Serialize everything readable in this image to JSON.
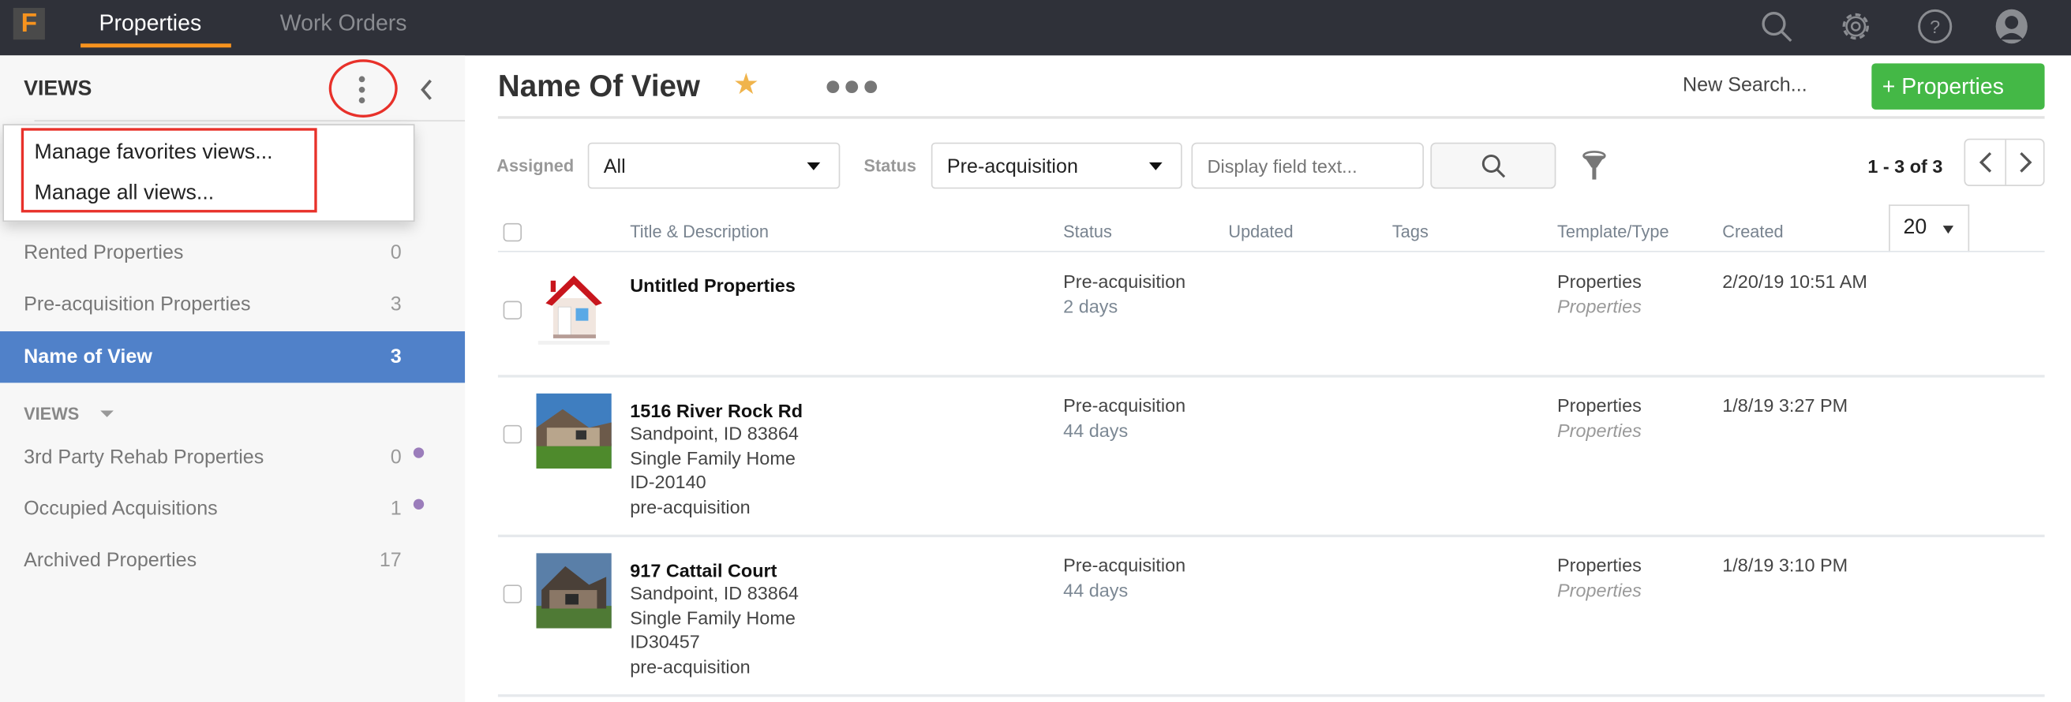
{
  "topbar": {
    "logo": "F",
    "tabs": [
      {
        "label": "Properties",
        "active": true
      },
      {
        "label": "Work Orders",
        "active": false
      }
    ],
    "icons": [
      "search-icon",
      "gear-icon",
      "help-icon",
      "user-icon"
    ],
    "accent": "#f7931e"
  },
  "sidebar": {
    "title": "VIEWS",
    "menu": {
      "items": [
        "Manage favorites views...",
        "Manage all views..."
      ]
    },
    "favorites": [
      {
        "label": "Rented Properties",
        "count": "0"
      },
      {
        "label": "Pre-acquisition Properties",
        "count": "3"
      },
      {
        "label": "Name of View",
        "count": "3",
        "selected": true
      }
    ],
    "views_heading": "VIEWS",
    "views": [
      {
        "label": "3rd Party Rehab Properties",
        "count": "0",
        "dot": true
      },
      {
        "label": "Occupied Acquisitions",
        "count": "1",
        "dot": true
      },
      {
        "label": "Archived Properties",
        "count": "17",
        "dot": false
      }
    ],
    "selected_color": "#5081c9"
  },
  "main": {
    "title": "Name Of View",
    "new_search": "New Search...",
    "add_button": "+ Properties",
    "filters": {
      "assigned_label": "Assigned",
      "assigned_value": "All",
      "status_label": "Status",
      "status_value": "Pre-acquisition",
      "text_placeholder": "Display field text..."
    },
    "pagination": {
      "info": "1 - 3 of 3",
      "per_page": "20"
    },
    "columns": [
      "Title & Description",
      "Status",
      "Updated",
      "Tags",
      "Template/Type",
      "Created"
    ],
    "rows": [
      {
        "title": "Untitled Properties",
        "details": [],
        "status": "Pre-acquisition",
        "ago": "2 days",
        "updated": "",
        "tags": "",
        "template": "Properties",
        "type": "Properties",
        "created": "2/20/19 10:51 AM",
        "image": "house-icon"
      },
      {
        "title": "1516 River Rock Rd",
        "details": [
          "Sandpoint, ID 83864",
          "Single Family Home",
          "ID-20140",
          "pre-acquisition"
        ],
        "status": "Pre-acquisition",
        "ago": "44 days",
        "updated": "",
        "tags": "",
        "template": "Properties",
        "type": "Properties",
        "created": "1/8/19 3:27 PM",
        "image": "house-photo"
      },
      {
        "title": "917 Cattail Court",
        "details": [
          "Sandpoint, ID 83864",
          "Single Family Home",
          "ID30457",
          "pre-acquisition"
        ],
        "status": "Pre-acquisition",
        "ago": "44 days",
        "updated": "",
        "tags": "",
        "template": "Properties",
        "type": "Properties",
        "created": "1/8/19 3:10 PM",
        "image": "house-photo"
      }
    ]
  }
}
